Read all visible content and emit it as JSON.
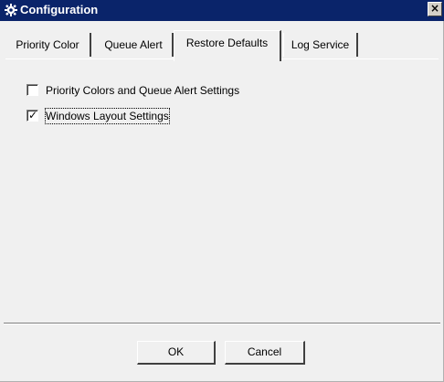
{
  "window": {
    "title": "Configuration",
    "close_label": "×"
  },
  "tabs": [
    {
      "label": "Priority Color",
      "active": false
    },
    {
      "label": "Queue Alert",
      "active": false
    },
    {
      "label": "Restore Defaults",
      "active": true
    },
    {
      "label": "Log Service",
      "active": false
    }
  ],
  "options": [
    {
      "label": "Priority Colors and Queue Alert Settings",
      "checked": false
    },
    {
      "label": "Windows Layout Settings",
      "checked": true
    }
  ],
  "buttons": {
    "ok_label": "OK",
    "cancel_label": "Cancel"
  },
  "colors": {
    "titlebar": "#0a246a",
    "face": "#f0f0f0"
  },
  "icons": {
    "title": "gear-icon",
    "close": "close-icon"
  }
}
